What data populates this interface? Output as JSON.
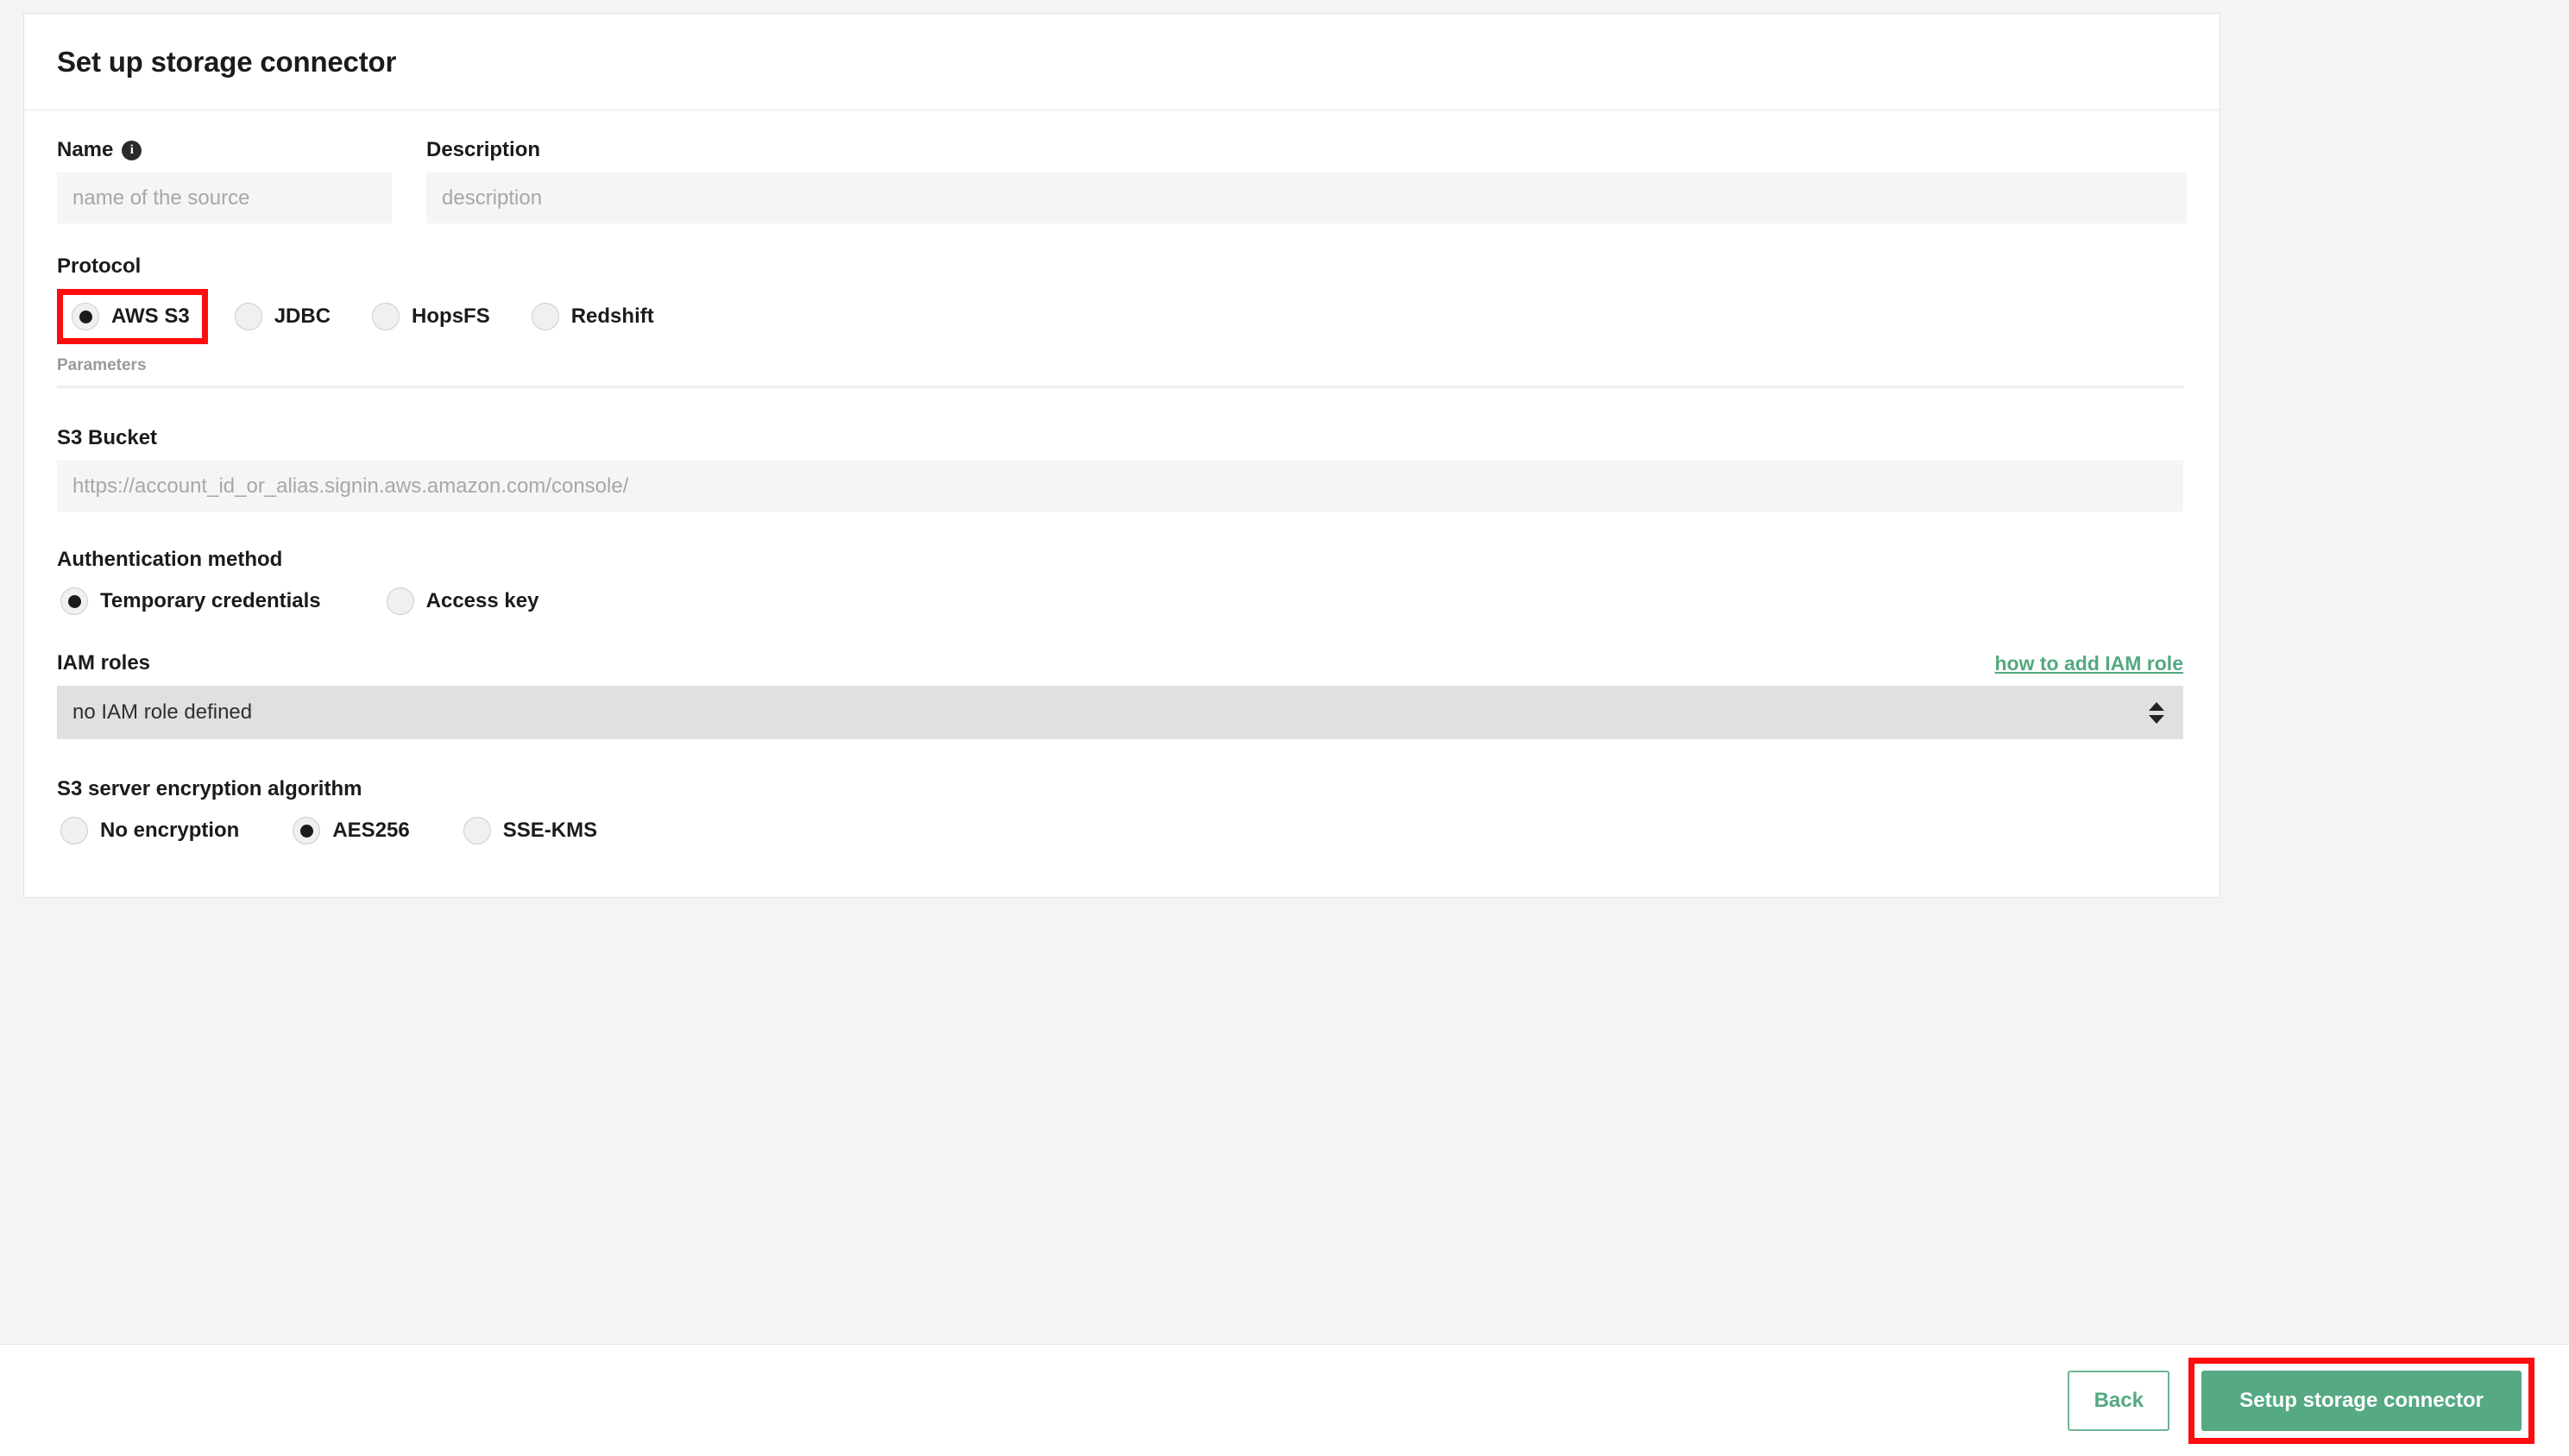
{
  "card": {
    "title": "Set up storage connector"
  },
  "name_field": {
    "label": "Name",
    "info_icon": "info-icon",
    "placeholder": "name of the source",
    "value": ""
  },
  "description_field": {
    "label": "Description",
    "placeholder": "description",
    "value": ""
  },
  "protocol": {
    "label": "Protocol",
    "selected": "AWS S3",
    "options": [
      {
        "label": "AWS S3",
        "checked": true,
        "highlighted": true
      },
      {
        "label": "JDBC",
        "checked": false,
        "highlighted": false
      },
      {
        "label": "HopsFS",
        "checked": false,
        "highlighted": false
      },
      {
        "label": "Redshift",
        "checked": false,
        "highlighted": false
      }
    ]
  },
  "parameters": {
    "caption": "Parameters"
  },
  "bucket_field": {
    "label": "S3 Bucket",
    "placeholder": "https://account_id_or_alias.signin.aws.amazon.com/console/",
    "value": ""
  },
  "auth_method": {
    "label": "Authentication method",
    "selected": "Temporary credentials",
    "options": [
      {
        "label": "Temporary credentials",
        "checked": true
      },
      {
        "label": "Access key",
        "checked": false
      }
    ]
  },
  "iam_roles": {
    "label": "IAM roles",
    "help_link": "how to add IAM role",
    "selected": "no IAM role defined",
    "options": [
      "no IAM role defined"
    ],
    "stepper_up_icon": "triangle-up-icon",
    "stepper_down_icon": "triangle-down-icon"
  },
  "encryption": {
    "label": "S3 server encryption algorithm",
    "selected": "AES256",
    "options": [
      {
        "label": "No encryption",
        "checked": false
      },
      {
        "label": "AES256",
        "checked": true
      },
      {
        "label": "SSE-KMS",
        "checked": false
      }
    ]
  },
  "footer": {
    "back_label": "Back",
    "submit_label": "Setup storage connector",
    "submit_highlighted": true
  },
  "colors": {
    "accent_green": "#55a983",
    "link_green": "#54a97f",
    "highlight_red": "#fd0d0d",
    "page_background": "#f4f4f4",
    "input_background": "#f5f5f5",
    "select_background": "#e0e0e0"
  }
}
